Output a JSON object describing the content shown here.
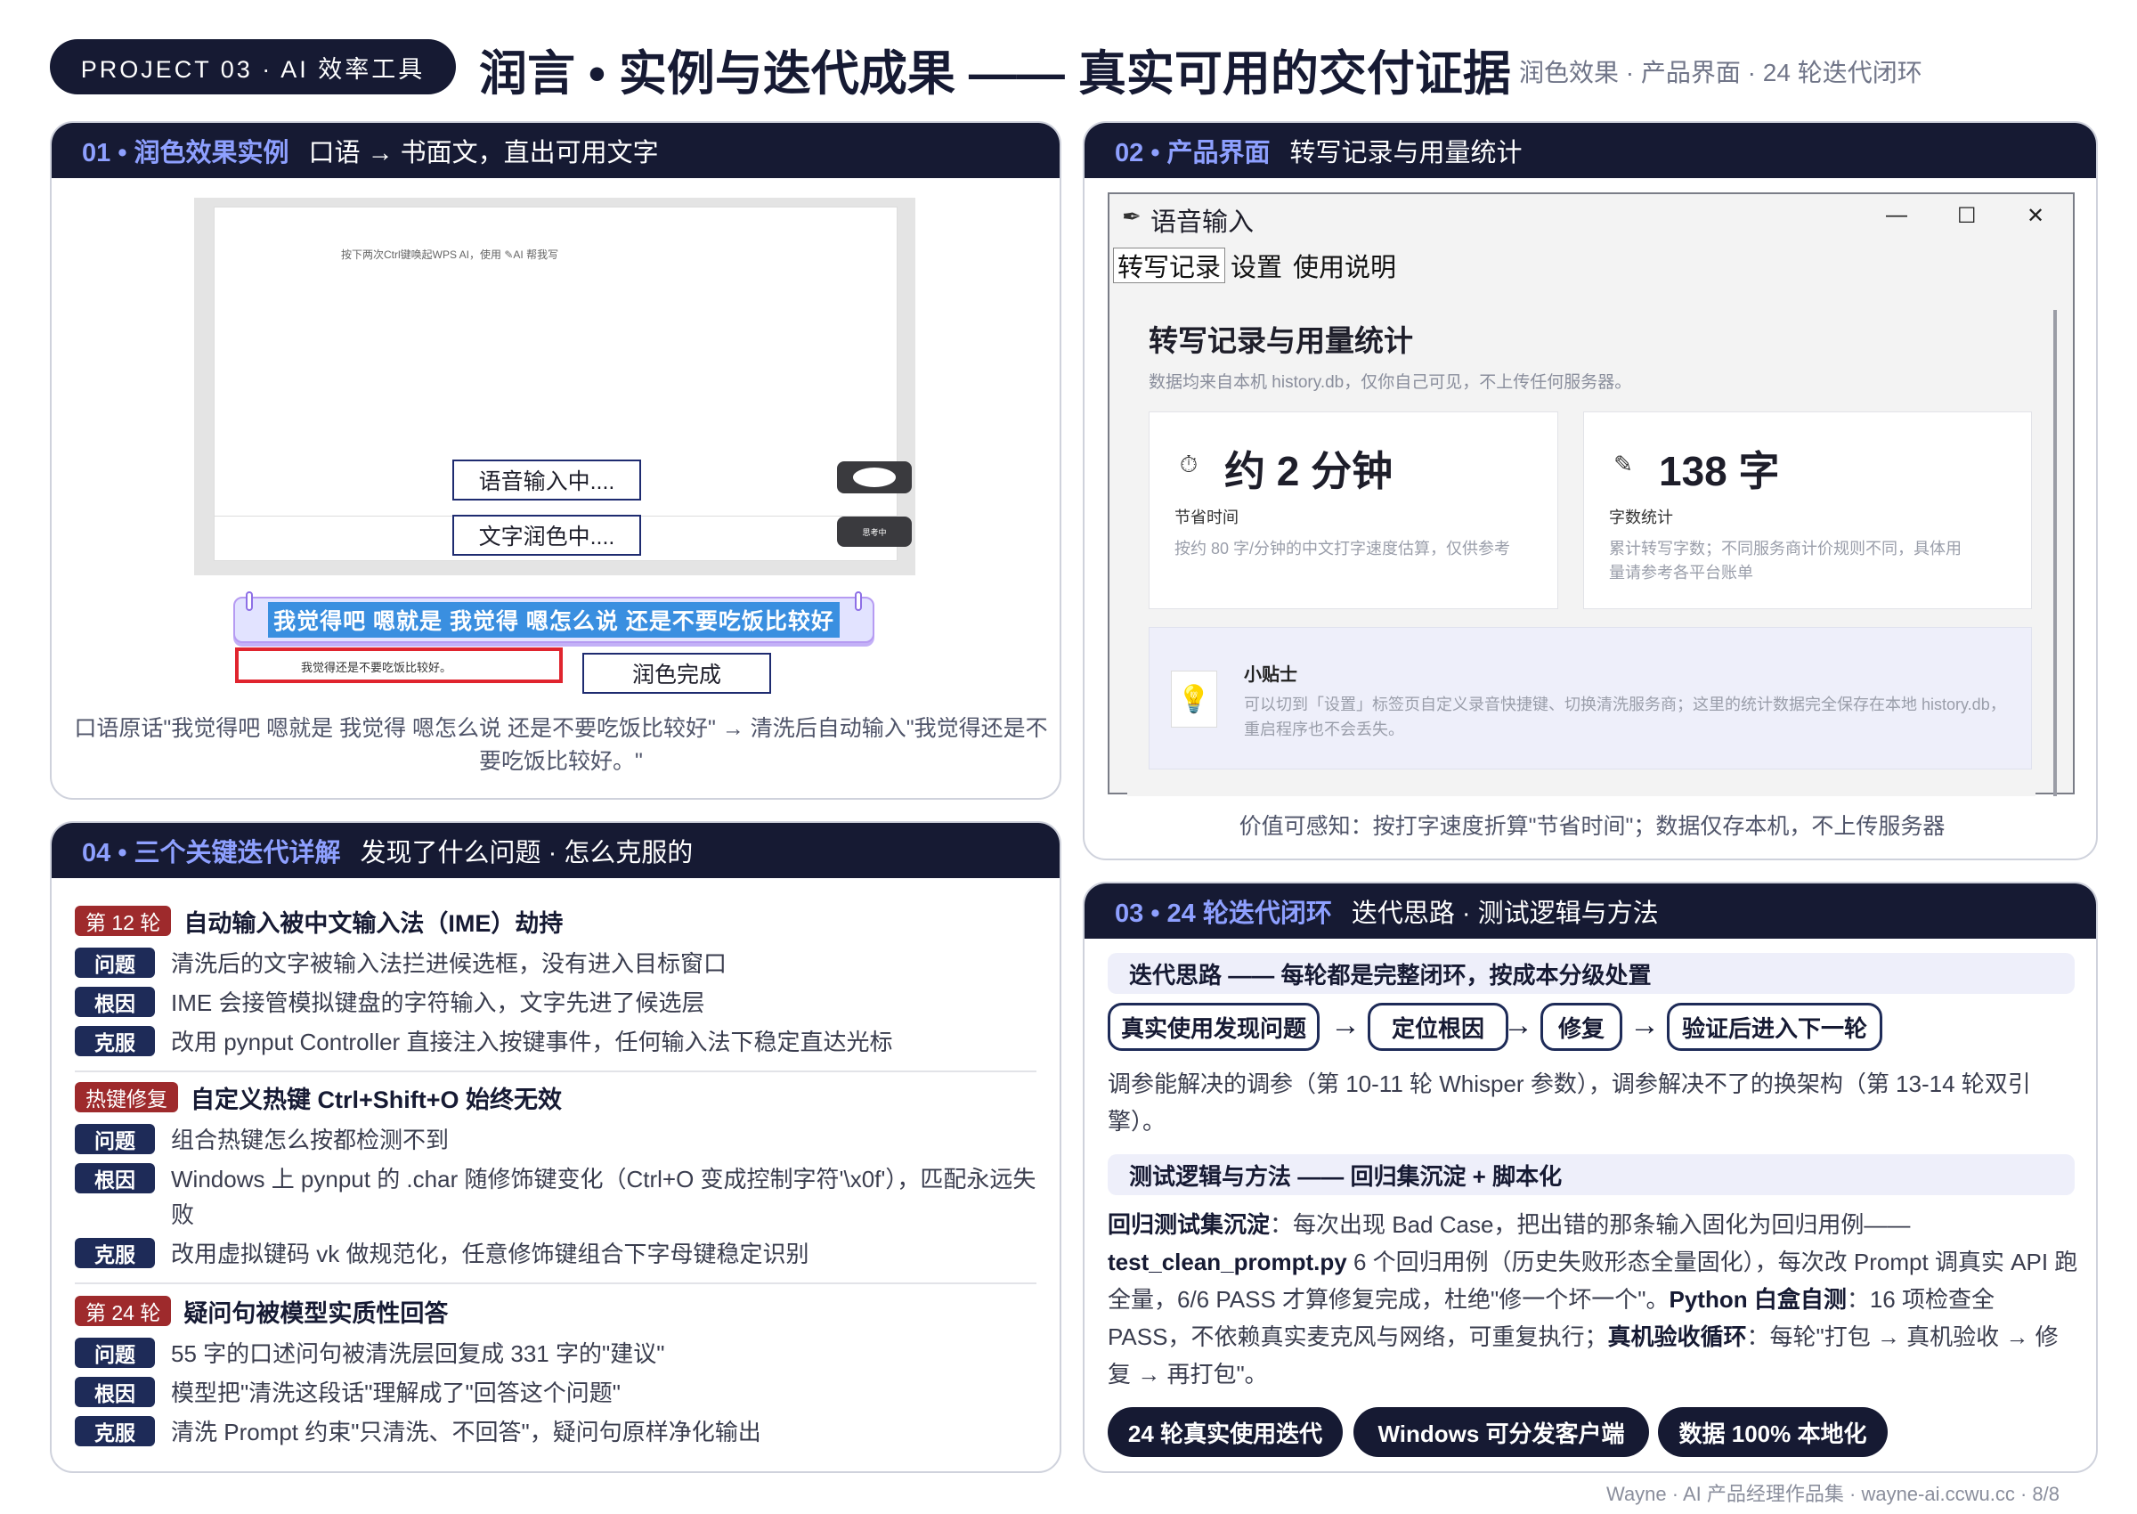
{
  "header": {
    "project": "PROJECT 03 · AI 效率工具",
    "title": "润言 • 实例与迭代成果 —— 真实可用的交付证据",
    "subtitle": "润色效果 · 产品界面 · 24 轮迭代闭环"
  },
  "card01": {
    "num": "01 • 润色效果实例",
    "title": "口语 → 书面文，直出可用文字",
    "screenshot": {
      "hint": "按下两次Ctrl键唤起WPS AI，使用 ✎AI 帮我写",
      "voice_status": "语音输入中....",
      "polish_status": "文字润色中....",
      "thinking": "思考中",
      "spoken_text": "我觉得吧 嗯就是 我觉得 嗯怎么说 还是不要吃饭比较好",
      "output_text": "我觉得还是不要吃饭比较好。",
      "done_status": "润色完成"
    },
    "caption": "口语原话\"我觉得吧 嗯就是 我觉得 嗯怎么说 还是不要吃饭比较好\" → 清洗后自动输入\"我觉得还是不要吃饭比较好。\""
  },
  "card02": {
    "num": "02 • 产品界面",
    "title": "转写记录与用量统计",
    "window": {
      "title": "语音输入",
      "minimize": "—",
      "maximize": "☐",
      "close": "✕",
      "tabs": [
        "转写记录",
        "设置",
        "使用说明"
      ],
      "heading": "转写记录与用量统计",
      "note": "数据均来自本机 history.db，仅你自己可见，不上传任何服务器。",
      "stats": [
        {
          "icon": "stopwatch-icon",
          "big": "约 2 分钟",
          "label": "节省时间",
          "small": "按约 80 字/分钟的中文打字速度估算，仅供参考"
        },
        {
          "icon": "edit-document-icon",
          "big": "138 字",
          "label": "字数统计",
          "small": "累计转写字数；不同服务商计价规则不同，具体用量请参考各平台账单"
        }
      ],
      "tip_title": "小贴士",
      "tip_body": "可以切到「设置」标签页自定义录音快捷键、切换清洗服务商；这里的统计数据完全保存在本地 history.db，重启程序也不会丢失。"
    },
    "caption": "价值可感知：按打字速度折算\"节省时间\"；数据仅存本机，不上传服务器"
  },
  "card04": {
    "num": "04 • 三个关键迭代详解",
    "title": "发现了什么问题 · 怎么克服的",
    "iterations": [
      {
        "tag": "第 12 轮",
        "name": "自动输入被中文输入法（IME）劫持",
        "rows": [
          {
            "k": "问题",
            "v": "清洗后的文字被输入法拦进候选框，没有进入目标窗口"
          },
          {
            "k": "根因",
            "v": "IME 会接管模拟键盘的字符输入，文字先进了候选层"
          },
          {
            "k": "克服",
            "v": "改用 pynput Controller 直接注入按键事件，任何输入法下稳定直达光标"
          }
        ]
      },
      {
        "tag": "热键修复",
        "name": "自定义热键 Ctrl+Shift+O 始终无效",
        "rows": [
          {
            "k": "问题",
            "v": "组合热键怎么按都检测不到"
          },
          {
            "k": "根因",
            "v": "Windows 上 pynput 的 .char 随修饰键变化（Ctrl+O 变成控制字符'\\x0f'），匹配永远失败"
          },
          {
            "k": "克服",
            "v": "改用虚拟键码 vk 做规范化，任意修饰键组合下字母键稳定识别"
          }
        ]
      },
      {
        "tag": "第 24 轮",
        "name": "疑问句被模型实质性回答",
        "rows": [
          {
            "k": "问题",
            "v": "55 字的口述问句被清洗层回复成 331 字的\"建议\""
          },
          {
            "k": "根因",
            "v": "模型把\"清洗这段话\"理解成了\"回答这个问题\""
          },
          {
            "k": "克服",
            "v": "清洗 Prompt 约束\"只清洗、不回答\"，疑问句原样净化输出"
          }
        ]
      }
    ]
  },
  "card03": {
    "num": "03 • 24 轮迭代闭环",
    "title": "迭代思路 · 测试逻辑与方法",
    "section1": "迭代思路 —— 每轮都是完整闭环，按成本分级处置",
    "steps": [
      "真实使用发现问题",
      "定位根因",
      "修复",
      "验证后进入下一轮"
    ],
    "arrow": "→",
    "para1": "调参能解决的调参（第 10-11 轮 Whisper 参数），调参解决不了的换架构（第 13-14 轮双引擎）。",
    "section2": "测试逻辑与方法 —— 回归集沉淀 + 脚本化",
    "p2_b1": "回归测试集沉淀",
    "p2_t1": "：每次出现 Bad Case，把出错的那条输入固化为回归用例——",
    "p2_b2": "test_clean_prompt.py",
    "p2_t2": " 6 个回归用例（历史失败形态全量固化），每次改 Prompt 调真实 API 跑全量，6/6 PASS 才算修复完成，杜绝\"修一个坏一个\"。",
    "p2_b3": "Python 白盒自测",
    "p2_t3": "：16 项检查全 PASS，不依赖真实麦克风与网络，可重复执行；",
    "p2_b4": "真机验收循环",
    "p2_t4": "：每轮\"打包 → 真机验收 → 修复 → 再打包\"。",
    "badges": [
      "24 轮真实使用迭代",
      "Windows 可分发客户端",
      "数据 100% 本地化"
    ]
  },
  "footer": "Wayne · AI 产品经理作品集 · wayne-ai.ccwu.cc · 8/8"
}
